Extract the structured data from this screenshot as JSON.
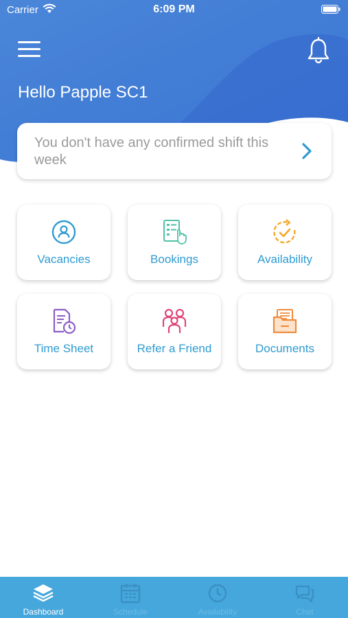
{
  "status_bar": {
    "carrier": "Carrier",
    "time": "6:09 PM"
  },
  "header": {
    "greeting": "Hello Papple SC1"
  },
  "shift_notice": {
    "text": "You don't have any confirmed shift this week"
  },
  "tiles": [
    {
      "label": "Vacancies",
      "icon": "person-circle-icon",
      "color": "#2e9bd1"
    },
    {
      "label": "Bookings",
      "icon": "booking-list-icon",
      "color": "#4fc1a6"
    },
    {
      "label": "Availability",
      "icon": "clock-check-icon",
      "color": "#f4a825"
    },
    {
      "label": "Time Sheet",
      "icon": "timesheet-icon",
      "color": "#8a5cc7"
    },
    {
      "label": "Refer a Friend",
      "icon": "people-icon",
      "color": "#e0457b"
    },
    {
      "label": "Documents",
      "icon": "folder-icon",
      "color": "#f08a3a"
    }
  ],
  "tabbar": {
    "items": [
      {
        "label": "Dashboard",
        "active": true
      },
      {
        "label": "Schedule",
        "active": false
      },
      {
        "label": "Availability",
        "active": false
      },
      {
        "label": "Chat",
        "active": false
      }
    ]
  },
  "colors": {
    "header_blue": "#3a7bd5",
    "tile_label": "#2e9bd1",
    "tabbar": "#45a7dc",
    "chevron": "#2e9bd1"
  }
}
